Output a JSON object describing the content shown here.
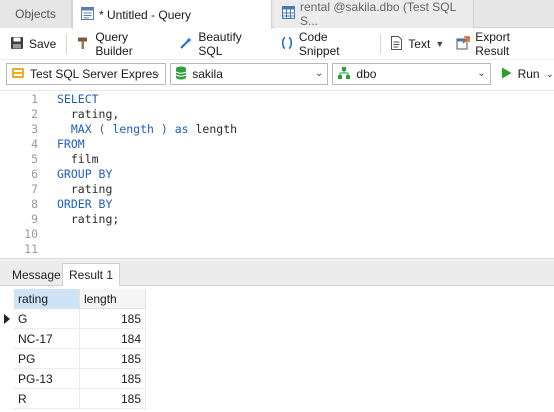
{
  "tabs": {
    "objects": "Objects",
    "query": "* Untitled - Query",
    "rental": "rental @sakila.dbo (Test SQL S..."
  },
  "toolbar": {
    "save": "Save",
    "query_builder": "Query Builder",
    "beautify_sql": "Beautify SQL",
    "code_snippet": "Code Snippet",
    "text": "Text",
    "export_result": "Export Result"
  },
  "connection": {
    "server": "Test SQL Server Expres",
    "database": "sakila",
    "schema": "dbo",
    "run": "Run"
  },
  "editor": {
    "lines": [
      {
        "num": "1",
        "kw": "SELECT",
        "text": ""
      },
      {
        "num": "2",
        "kw": "",
        "text": "  rating,"
      },
      {
        "num": "3",
        "kw": "",
        "pre": "  ",
        "text": "MAX ( length ) ",
        "kw2": "as",
        "post": " length"
      },
      {
        "num": "4",
        "kw": "FROM",
        "text": ""
      },
      {
        "num": "5",
        "kw": "",
        "text": "  film"
      },
      {
        "num": "6",
        "kw": "GROUP BY",
        "text": ""
      },
      {
        "num": "7",
        "kw": "",
        "text": "  rating"
      },
      {
        "num": "8",
        "kw": "ORDER BY",
        "text": ""
      },
      {
        "num": "9",
        "kw": "",
        "text": "  rating;"
      },
      {
        "num": "10",
        "kw": "",
        "text": ""
      },
      {
        "num": "11",
        "kw": "",
        "text": ""
      }
    ]
  },
  "result_tabs": {
    "message": "Message",
    "result": "Result 1"
  },
  "grid": {
    "columns": [
      "rating",
      "length"
    ],
    "rows": [
      [
        "G",
        "185"
      ],
      [
        "NC-17",
        "184"
      ],
      [
        "PG",
        "185"
      ],
      [
        "PG-13",
        "185"
      ],
      [
        "R",
        "185"
      ]
    ]
  },
  "colors": {
    "keyword": "#1f5fbf",
    "selected_header": "#cfe3f7",
    "run_green": "#2ca02c"
  }
}
